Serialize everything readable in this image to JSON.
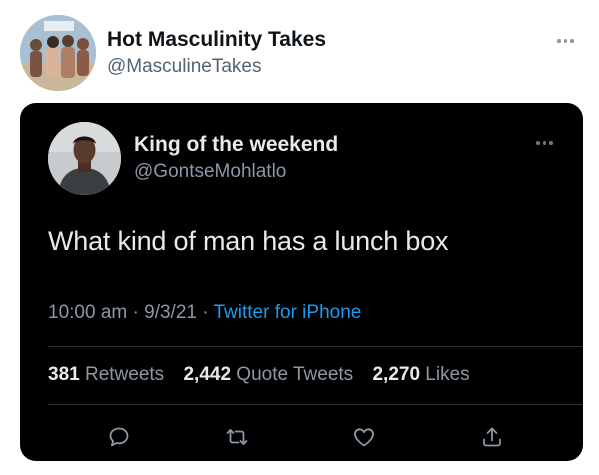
{
  "outer_tweet": {
    "display_name": "Hot Masculinity Takes",
    "handle": "@MasculineTakes",
    "avatar_icon": "group-photo-avatar",
    "more_icon": "more-dots-icon"
  },
  "quoted_tweet": {
    "display_name": "King of the weekend",
    "handle": "@GontseMohlatlo",
    "avatar_icon": "person-photo-avatar",
    "text": "What kind of man has a lunch box",
    "time": "10:00 am",
    "date": "9/3/21",
    "separator": "·",
    "source": "Twitter for iPhone",
    "stats": {
      "retweets_count": "381",
      "retweets_label": "Retweets",
      "quotes_count": "2,442",
      "quotes_label": "Quote Tweets",
      "likes_count": "2,270",
      "likes_label": "Likes"
    },
    "actions": [
      "reply-icon",
      "retweet-icon",
      "like-icon",
      "share-icon"
    ]
  },
  "colors": {
    "card_background": "#000000",
    "primary_text_dark": "#e7e9ea",
    "secondary_text_dark": "#8b98a5",
    "link_blue": "#1d9bf0",
    "primary_text_light": "#0f1419",
    "secondary_text_light": "#536471"
  }
}
